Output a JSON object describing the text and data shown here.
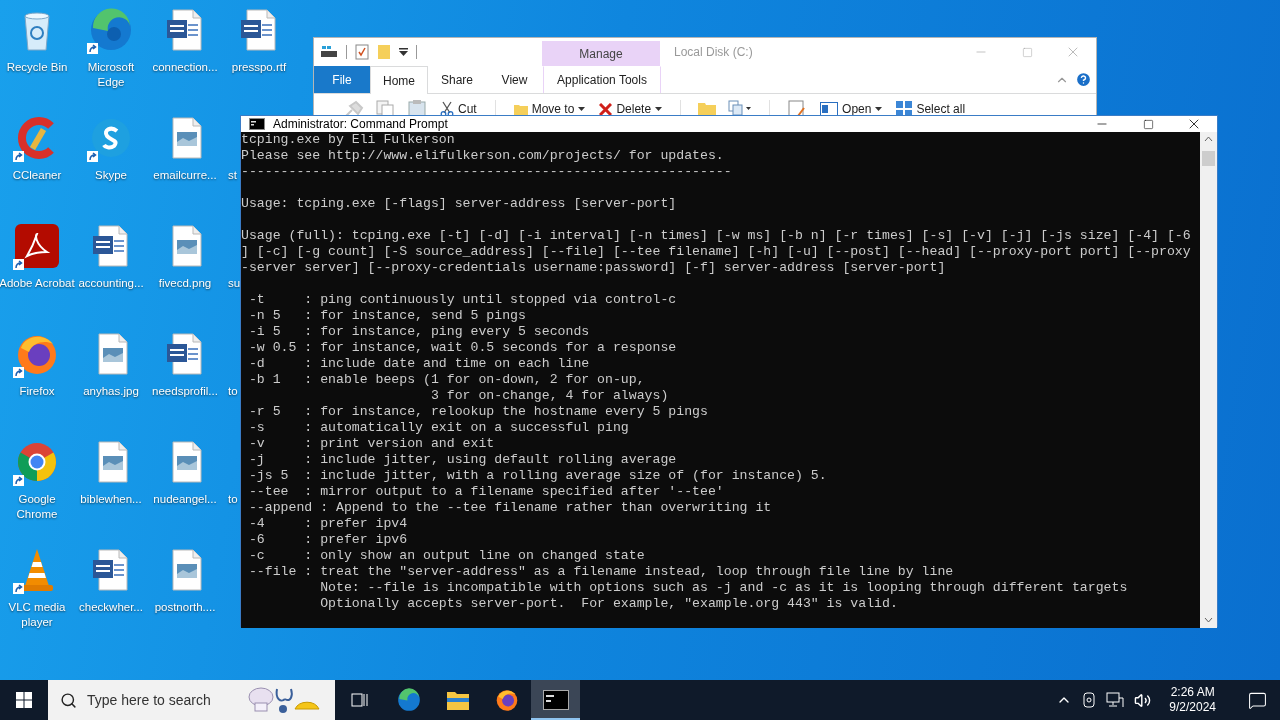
{
  "desktop": {
    "icons": [
      {
        "label": "Recycle Bin",
        "kind": "recycle",
        "shortcut": false
      },
      {
        "label": "Microsoft Edge",
        "kind": "edge",
        "shortcut": true
      },
      {
        "label": "connection...",
        "kind": "word",
        "shortcut": false
      },
      {
        "label": "presspo.rtf",
        "kind": "word",
        "shortcut": false
      },
      {
        "label": "CCleaner",
        "kind": "ccleaner",
        "shortcut": true
      },
      {
        "label": "Skype",
        "kind": "skype",
        "shortcut": true
      },
      {
        "label": "emailcurre...",
        "kind": "image",
        "shortcut": false
      },
      {
        "label": "st",
        "kind": "covered"
      },
      {
        "label": "Adobe Acrobat",
        "kind": "acrobat",
        "shortcut": true
      },
      {
        "label": "accounting...",
        "kind": "word",
        "shortcut": false
      },
      {
        "label": "fivecd.png",
        "kind": "image",
        "shortcut": false
      },
      {
        "label": "su",
        "kind": "covered"
      },
      {
        "label": "Firefox",
        "kind": "firefox",
        "shortcut": true
      },
      {
        "label": "anyhas.jpg",
        "kind": "image",
        "shortcut": false
      },
      {
        "label": "needsprofil...",
        "kind": "word",
        "shortcut": false
      },
      {
        "label": "to",
        "kind": "covered"
      },
      {
        "label": "Google Chrome",
        "kind": "chrome",
        "shortcut": true
      },
      {
        "label": "biblewhen...",
        "kind": "image",
        "shortcut": false
      },
      {
        "label": "nudeangel...",
        "kind": "image",
        "shortcut": false
      },
      {
        "label": "to",
        "kind": "covered"
      },
      {
        "label": "VLC media player",
        "kind": "vlc",
        "shortcut": true
      },
      {
        "label": "checkwher...",
        "kind": "word",
        "shortcut": false
      },
      {
        "label": "postnorth....",
        "kind": "image",
        "shortcut": false
      }
    ]
  },
  "explorer": {
    "title": "Local Disk (C:)",
    "context_group": "Manage",
    "tabs": [
      {
        "label": "File",
        "kind": "file",
        "selected": false
      },
      {
        "label": "Home",
        "kind": "tab",
        "selected": true
      },
      {
        "label": "Share",
        "kind": "tab",
        "selected": false
      },
      {
        "label": "View",
        "kind": "tab",
        "selected": false
      },
      {
        "label": "Application Tools",
        "kind": "context",
        "selected": false
      }
    ],
    "ribbon": [
      {
        "kind": "pin"
      },
      {
        "kind": "copy"
      },
      {
        "kind": "paste"
      },
      {
        "kind": "cut",
        "label": "Cut",
        "dropdown": false
      },
      {
        "kind": "separator"
      },
      {
        "kind": "move",
        "label": "Move to",
        "dropdown": true
      },
      {
        "kind": "delete",
        "label": "Delete",
        "dropdown": true
      },
      {
        "kind": "separator"
      },
      {
        "kind": "folder"
      },
      {
        "kind": "copypath"
      },
      {
        "kind": "separator"
      },
      {
        "kind": "properties"
      },
      {
        "kind": "open",
        "label": "Open",
        "dropdown": true
      },
      {
        "kind": "select",
        "label": "Select all",
        "dropdown": false
      }
    ]
  },
  "console": {
    "title": "Administrator: Command Prompt",
    "blocks": [
      [
        "tcping.exe by Eli Fulkerson",
        "Please see http://www.elifulkerson.com/projects/ for updates.",
        "--------------------------------------------------------------"
      ],
      [
        "Usage: tcping.exe [-flags] server-address [server-port]"
      ],
      [
        "Usage (full): tcping.exe [-t] [-d] [-i interval] [-n times] [-w ms] [-b n] [-r times] [-s] [-v] [-j] [-js size] [-4] [-6",
        "] [-c] [-g count] [-S source_address] [--file] [--tee filename] [-h] [-u] [--post] [--head] [--proxy-port port] [--proxy",
        "-server server] [--proxy-credentials username:password] [-f] server-address [server-port]"
      ],
      [
        " -t     : ping continuously until stopped via control-c",
        " -n 5   : for instance, send 5 pings",
        " -i 5   : for instance, ping every 5 seconds",
        " -w 0.5 : for instance, wait 0.5 seconds for a response",
        " -d     : include date and time on each line",
        " -b 1   : enable beeps (1 for on-down, 2 for on-up,",
        "                        3 for on-change, 4 for always)",
        " -r 5   : for instance, relookup the hostname every 5 pings",
        " -s     : automatically exit on a successful ping",
        " -v     : print version and exit",
        " -j     : include jitter, using default rolling average",
        " -js 5  : include jitter, with a rolling average size of (for instance) 5.",
        " --tee  : mirror output to a filename specified after '--tee'",
        " --append : Append to the --tee filename rather than overwriting it",
        " -4     : prefer ipv4",
        " -6     : prefer ipv6",
        " -c     : only show an output line on changed state",
        " --file : treat the \"server-address\" as a filename instead, loop through file line by line",
        "          Note: --file is incompatible with options such as -j and -c as it is looping through different targets",
        "          Optionally accepts server-port.  For example, \"example.org 443\" is valid."
      ]
    ]
  },
  "taskbar": {
    "search": {
      "placeholder": "Type here to search"
    },
    "apps": [
      {
        "kind": "taskview",
        "active": false
      },
      {
        "kind": "edge",
        "active": false
      },
      {
        "kind": "explorer",
        "active": false
      },
      {
        "kind": "firefox",
        "active": false
      },
      {
        "kind": "cmd",
        "active": true
      }
    ],
    "clock": {
      "time": "2:26 AM",
      "date": "9/2/2024"
    }
  }
}
